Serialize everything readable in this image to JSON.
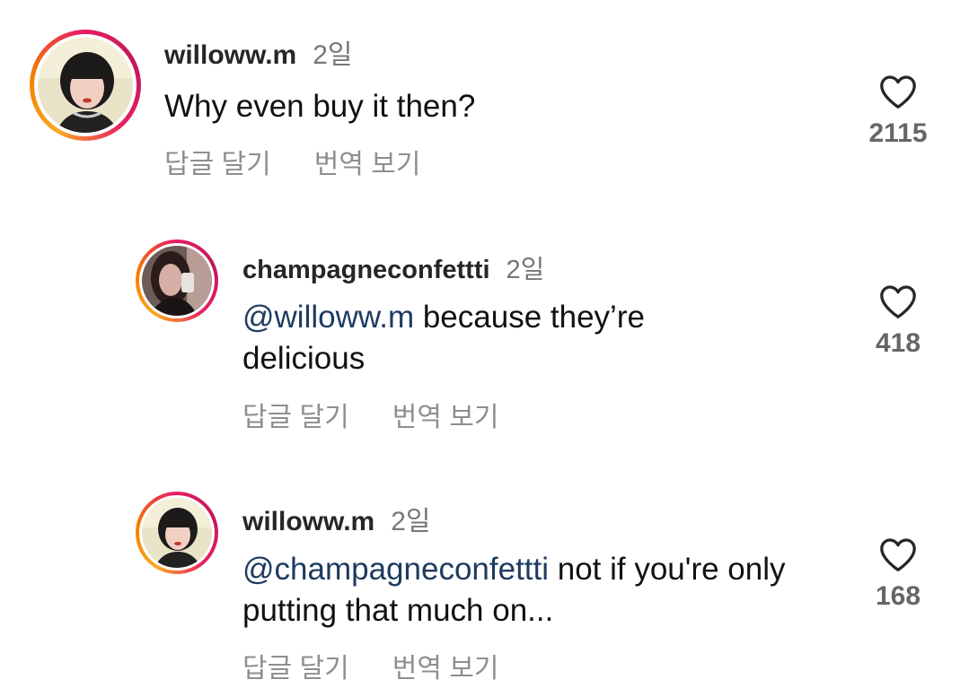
{
  "comments": [
    {
      "username": "willoww.m",
      "time": "2일",
      "mention": "",
      "text": "Why even buy it then?",
      "reply_label": "답글 달기",
      "translate_label": "번역 보기",
      "likes": "2115"
    },
    {
      "username": "champagneconfettti",
      "time": "2일",
      "mention": "@willoww.m",
      "text": " because they’re delicious",
      "reply_label": "답글 달기",
      "translate_label": "번역 보기",
      "likes": "418"
    },
    {
      "username": "willoww.m",
      "time": "2일",
      "mention": "@champagneconfettti",
      "text": " not if you're only putting that much on...",
      "reply_label": "답글 달기",
      "translate_label": "번역 보기",
      "likes": "168"
    }
  ],
  "colors": {
    "mention": "#1e3a5f",
    "secondary_text": "#8e8e8e",
    "story_ring_start": "#f9a825",
    "story_ring_end": "#e91e63"
  },
  "icons": {
    "like": "heart-outline-icon"
  }
}
